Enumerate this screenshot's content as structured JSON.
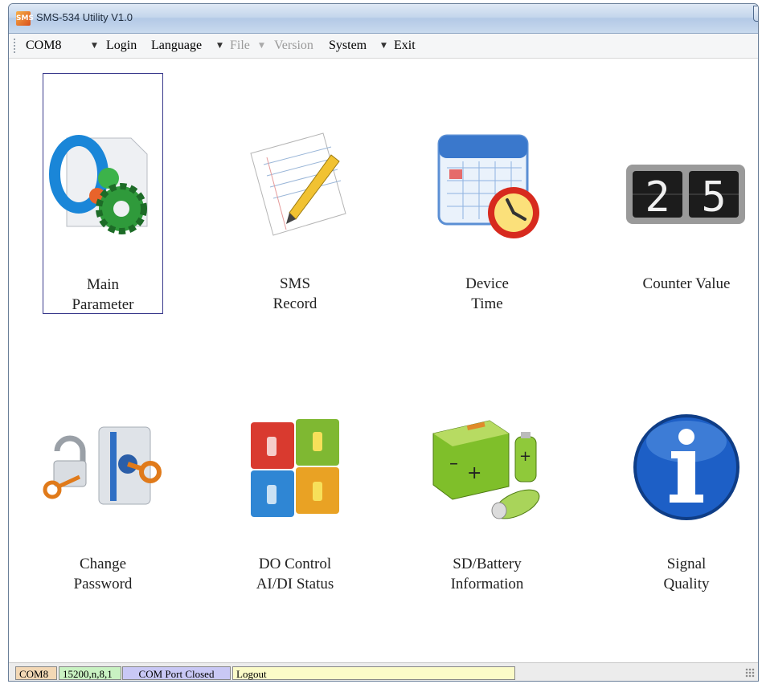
{
  "window": {
    "title": "SMS-534 Utility V1.0",
    "app_icon": "app-icon"
  },
  "menubar": {
    "com_port": "COM8",
    "items": [
      {
        "label": "Login",
        "enabled": true
      },
      {
        "label": "Language",
        "enabled": true
      },
      {
        "label": "File",
        "enabled": false
      },
      {
        "label": "Version",
        "enabled": false
      },
      {
        "label": "System",
        "enabled": true
      },
      {
        "label": "Exit",
        "enabled": true
      }
    ]
  },
  "tiles": [
    {
      "line1": "Main",
      "line2": "Parameter",
      "icon": "parameter-gear-icon",
      "selected": true
    },
    {
      "line1": "SMS",
      "line2": "Record",
      "icon": "notepad-pencil-icon"
    },
    {
      "line1": "Device",
      "line2": "Time",
      "icon": "calendar-clock-icon"
    },
    {
      "line1": "",
      "line2": "Counter Value",
      "icon": "digital-counter-icon",
      "counter_digits": [
        "2",
        "5"
      ]
    },
    {
      "line1": "Change",
      "line2": "Password",
      "icon": "lock-key-icon"
    },
    {
      "line1": "DO Control",
      "line2": "AI/DI Status",
      "icon": "switches-icon"
    },
    {
      "line1": "SD/Battery",
      "line2": "Information",
      "icon": "battery-icon"
    },
    {
      "line1": "Signal",
      "line2": "Quality",
      "icon": "info-icon"
    }
  ],
  "statusbar": {
    "port": "COM8",
    "settings": "15200,n,8,1",
    "port_state": "COM Port Closed",
    "login_state": "Logout"
  },
  "colors": {
    "status_port_bg": "#f3d8b5",
    "status_settings_bg": "#c9f2c2",
    "status_state_bg": "#c9c8f5",
    "status_login_bg": "#fbfbc8"
  }
}
